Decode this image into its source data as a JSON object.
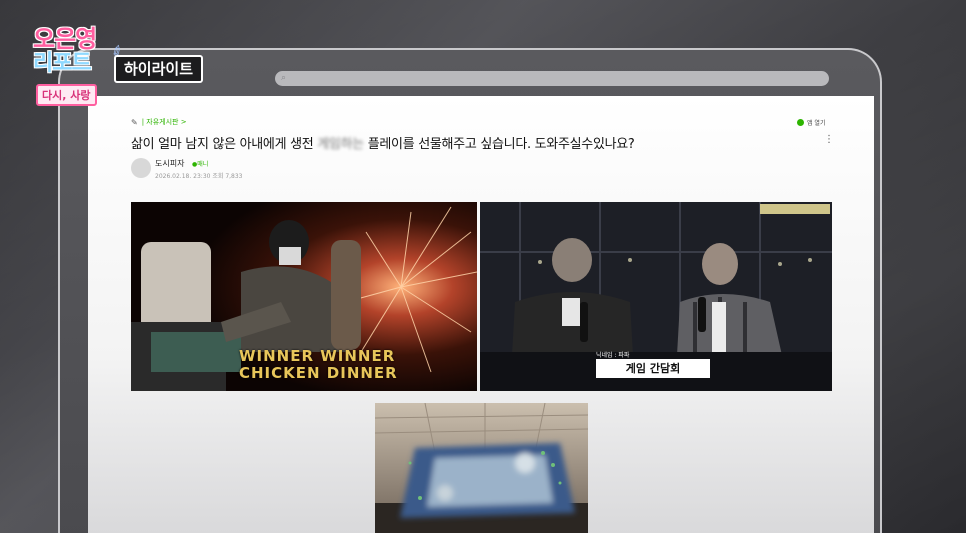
{
  "overlay": {
    "logo_line1": "오은영",
    "logo_line2": "리포트",
    "logo_line3": "다시, 사랑",
    "highlight_badge": "하이라이트"
  },
  "post": {
    "board_name": "| 자유게시판 >",
    "open_app_label": "앱 열기",
    "title_before": "삶이 얼마 남지 않은 아내에게 생전",
    "title_blurred": "게임하는",
    "title_after": "플레이를 선물해주고 싶습니다. 도와주실수있나요?",
    "author": "도시피자",
    "author_badge": "●매니",
    "meta": "2026.02.18. 23:30  조회 7,833"
  },
  "images": {
    "game_caption_line1": "WINNER WINNER",
    "game_caption_line2": "CHICKEN DINNER",
    "broadcast_subtitle": "닉네임 : 파파",
    "broadcast_caption": "게임 간담회"
  },
  "colors": {
    "naver_green": "#2db400",
    "logo_pink": "#ff5fa0",
    "logo_blue": "#8fd9ff"
  }
}
